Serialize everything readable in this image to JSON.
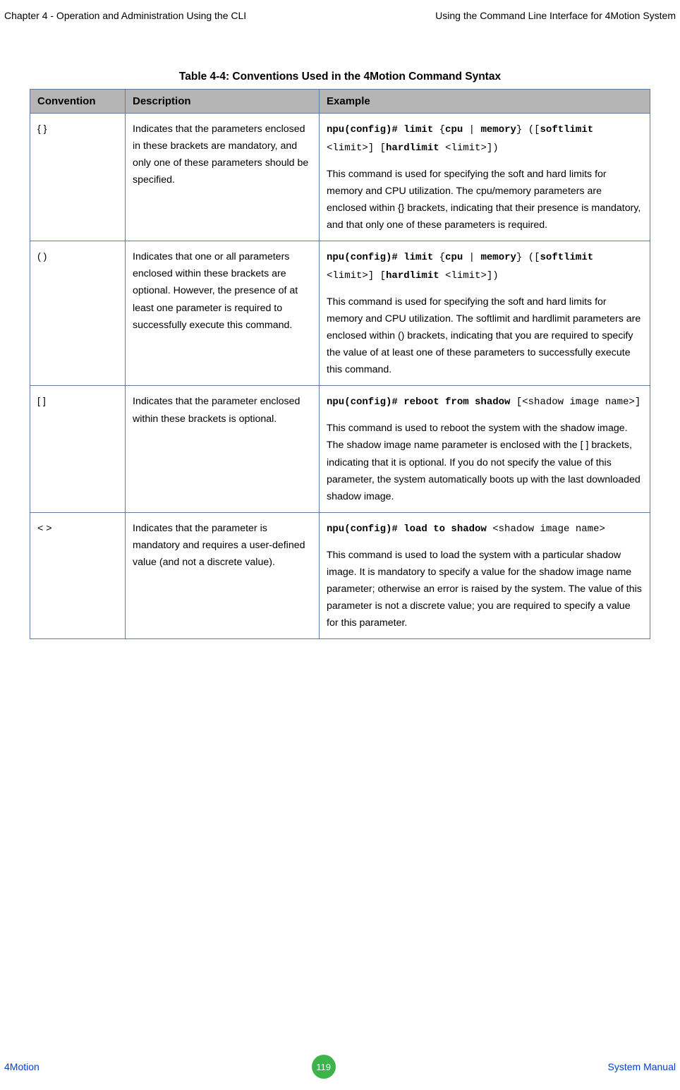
{
  "header": {
    "left": "Chapter 4 - Operation and Administration Using the CLI",
    "right": "Using the Command Line Interface for 4Motion System"
  },
  "table": {
    "title": "Table 4-4: Conventions Used in the 4Motion Command Syntax",
    "headers": {
      "c1": "Convention",
      "c2": "Description",
      "c3": "Example"
    },
    "rows": [
      {
        "conv": "{ }",
        "desc": "Indicates that the parameters enclosed in these brackets are mandatory, and only one of these parameters should be specified.",
        "ex_cmd_1": "npu(config)# limit",
        "ex_cmd_2": " {",
        "ex_cmd_3": "cpu",
        "ex_cmd_4": " | ",
        "ex_cmd_5": "memory",
        "ex_cmd_6": "} ([",
        "ex_cmd_7": "softlimit",
        "ex_cmd_8": " <limit>]  [",
        "ex_cmd_9": "hardlimit",
        "ex_cmd_10": " <limit>])",
        "ex_desc": "This command is used for specifying the soft and hard limits for memory and CPU utilization. The cpu/memory parameters are enclosed within {} brackets, indicating that their presence is mandatory, and that only one of these parameters is required."
      },
      {
        "conv": "( )",
        "desc": "Indicates that one or all parameters enclosed within these brackets are optional. However, the presence of at least one parameter is required to successfully execute this command.",
        "ex_cmd_1": "npu(config)# limit",
        "ex_cmd_2": " {",
        "ex_cmd_3": "cpu",
        "ex_cmd_4": " | ",
        "ex_cmd_5": "memory",
        "ex_cmd_6": "} ([",
        "ex_cmd_7": "softlimit",
        "ex_cmd_8": " <limit>]  [",
        "ex_cmd_9": "hardlimit",
        "ex_cmd_10": " <limit>])",
        "ex_desc": "This command is used for specifying the soft and hard limits for memory and CPU utilization. The softlimit and hardlimit parameters are enclosed within () brackets, indicating that you are required to specify the value of at least one of these parameters to successfully execute this command."
      },
      {
        "conv": "[ ]",
        "desc": "Indicates that the parameter enclosed within these brackets is optional.",
        "ex_cmd_a": "npu(config)# reboot from shadow",
        "ex_cmd_b": " [<shadow image name>]",
        "ex_desc": "This command is used to reboot the system with the shadow image. The shadow image name parameter is enclosed with the [ ] brackets, indicating that it is optional. If you do not specify the value of this parameter, the system automatically boots up with the last downloaded shadow image."
      },
      {
        "conv": "< >",
        "desc": "Indicates that the parameter is mandatory and requires a user-defined value (and not a discrete value).",
        "ex_cmd_a": "npu(config)# load to shadow",
        "ex_cmd_b": " <shadow image name>",
        "ex_desc": "This command is used to load the system with a particular shadow image. It is mandatory to specify a value for the shadow image name parameter; otherwise an error is raised by the system. The value of this parameter is not a discrete value; you are required to specify a value for this parameter."
      }
    ]
  },
  "footer": {
    "left": "4Motion",
    "page": "119",
    "right": "System Manual"
  }
}
